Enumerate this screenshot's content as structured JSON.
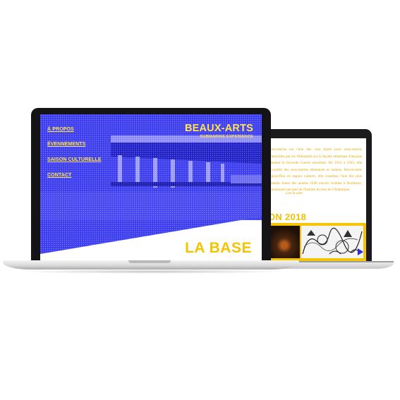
{
  "colors": {
    "accent_blue": "#3c3cf0",
    "accent_yellow": "#f5c400",
    "bezel": "#141416"
  },
  "front_site": {
    "nav": [
      {
        "label": "À PROPOS"
      },
      {
        "label": "ÉVENNEMENTS"
      },
      {
        "label": "SAISON CULTURELLE"
      },
      {
        "label": "CONTACT"
      }
    ],
    "brand": {
      "title": "BEAUX-ARTS",
      "subtitle": "SUBMARINE EXPERIENCE"
    },
    "hero_heading": "LA BASE"
  },
  "back_site": {
    "intro": "sous-marins est l'une des cinq bases pour sous-marins construites par les Allemands sur la façade atlantique française pendant la Seconde Guerre mondiale. De 1941 à 1943, elle accueillit des sous-marins allemands et italiens. Reconvertie aujourd'hui en espace culturel, elle constitue l'une des plus grandes bases des années 1940 encore visibles à Bordeaux, constituant une part de l'histoire du mur de l'Atlantique.",
    "read_more": "Lire la suite",
    "season_heading": "ON 2018",
    "next_icon": "play-arrow-icon"
  }
}
